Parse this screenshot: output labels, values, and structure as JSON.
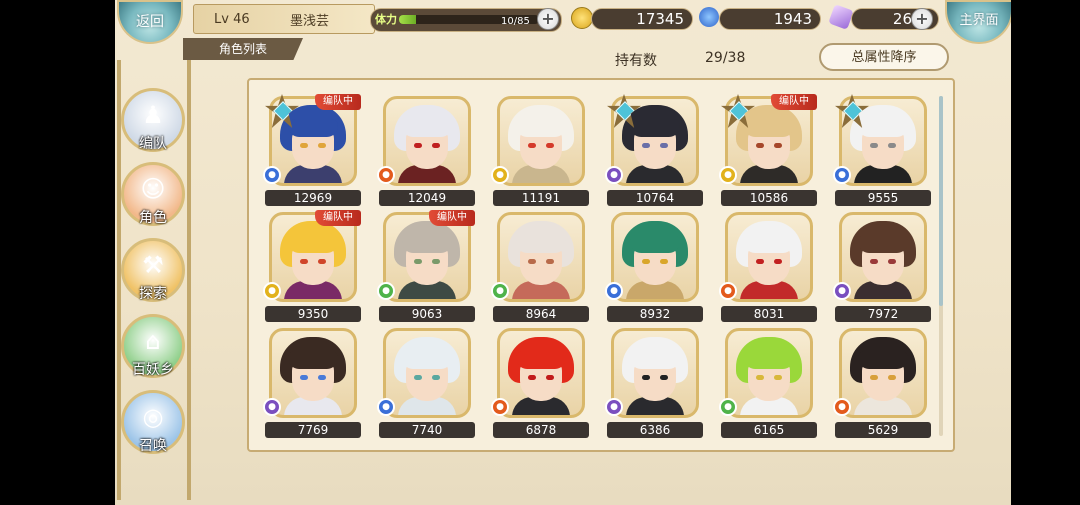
{
  "nav": {
    "back_label": "返回",
    "home_label": "主界面"
  },
  "profile": {
    "level": "Lv 46",
    "name": "墨浅芸"
  },
  "stamina": {
    "label": "体力",
    "value": "10/85",
    "fraction": 0.118
  },
  "currency": {
    "gold": {
      "value": "17345",
      "icon": "gold-coin-icon",
      "color": "#f2c230"
    },
    "spirit": {
      "value": "1943",
      "icon": "blue-flame-icon",
      "color": "#3f7dd9"
    },
    "crystal": {
      "value": "26",
      "icon": "crystal-icon",
      "color": "#b48fd4"
    }
  },
  "tab": {
    "label": "角色列表"
  },
  "owned": {
    "label": "持有数",
    "value": "29/38"
  },
  "sort_label": "总属性降序",
  "side_menu": [
    {
      "label": "编队",
      "glyph": "♟",
      "color": "#cfd9e6"
    },
    {
      "label": "角色",
      "glyph": "☺",
      "color": "#f2b88a"
    },
    {
      "label": "探索",
      "glyph": "⚒",
      "color": "#f0c266"
    },
    {
      "label": "百妖乡",
      "glyph": "⌂",
      "color": "#8fcf8a"
    },
    {
      "label": "召唤",
      "glyph": "◎",
      "color": "#9cc4e8"
    }
  ],
  "team_badge": "编队中",
  "characters": [
    {
      "power": "12969",
      "hair": "#2d4fa8",
      "eye": "#e0a53a",
      "cloth": "#3c3f6e",
      "element": "water",
      "elemColor": "#3a6fd8",
      "star": true,
      "team": true
    },
    {
      "power": "12049",
      "hair": "#e8e8ee",
      "eye": "#c02020",
      "cloth": "#6b2222",
      "element": "fire",
      "elemColor": "#e35a1c",
      "star": false,
      "team": false
    },
    {
      "power": "11191",
      "hair": "#f4f1ea",
      "eye": "#d43a2a",
      "cloth": "#c9b68e",
      "element": "light",
      "elemColor": "#e2b21c",
      "star": false,
      "team": false
    },
    {
      "power": "10764",
      "hair": "#2a2a33",
      "eye": "#6a6fa8",
      "cloth": "#2a2a2e",
      "element": "dark",
      "elemColor": "#7a4fbf",
      "star": true,
      "team": false
    },
    {
      "power": "10586",
      "hair": "#e3c58a",
      "eye": "#a6472a",
      "cloth": "#2e2b28",
      "element": "light",
      "elemColor": "#e2b21c",
      "star": true,
      "team": true
    },
    {
      "power": "9555",
      "hair": "#f2f2f2",
      "eye": "#8a8a8a",
      "cloth": "#222222",
      "element": "water",
      "elemColor": "#3a6fd8",
      "star": true,
      "team": false
    },
    {
      "power": "9350",
      "hair": "#f4c53a",
      "eye": "#d0452a",
      "cloth": "#7a2a66",
      "element": "light",
      "elemColor": "#e2b21c",
      "star": false,
      "team": true
    },
    {
      "power": "9063",
      "hair": "#bfb6aa",
      "eye": "#7a9a6a",
      "cloth": "#3e4a44",
      "element": "wind",
      "elemColor": "#4fb34a",
      "star": false,
      "team": true
    },
    {
      "power": "8964",
      "hair": "#e9e2dc",
      "eye": "#b86a4a",
      "cloth": "#c56a5a",
      "element": "wind",
      "elemColor": "#4fb34a",
      "star": false,
      "team": false
    },
    {
      "power": "8932",
      "hair": "#2a8a6a",
      "eye": "#d9a62a",
      "cloth": "#c9a76a",
      "element": "water",
      "elemColor": "#3a6fd8",
      "star": false,
      "team": false
    },
    {
      "power": "8031",
      "hair": "#f2f2f2",
      "eye": "#c22020",
      "cloth": "#c22a2a",
      "element": "fire",
      "elemColor": "#e35a1c",
      "star": false,
      "team": false
    },
    {
      "power": "7972",
      "hair": "#5a3a2a",
      "eye": "#9a3a3a",
      "cloth": "#3a2e30",
      "element": "dark",
      "elemColor": "#7a4fbf",
      "star": false,
      "team": false
    },
    {
      "power": "7769",
      "hair": "#3a2a22",
      "eye": "#4a7ad8",
      "cloth": "#e8e8ee",
      "element": "dark",
      "elemColor": "#7a4fbf",
      "star": false,
      "team": false
    },
    {
      "power": "7740",
      "hair": "#e8eef2",
      "eye": "#5aa8a0",
      "cloth": "#dfe6ea",
      "element": "water",
      "elemColor": "#3a6fd8",
      "star": false,
      "team": false
    },
    {
      "power": "6878",
      "hair": "#e22a1a",
      "eye": "#c21a1a",
      "cloth": "#2a2a2e",
      "element": "fire",
      "elemColor": "#e35a1c",
      "star": false,
      "team": false
    },
    {
      "power": "6386",
      "hair": "#f2f2f2",
      "eye": "#222222",
      "cloth": "#2a2a2e",
      "element": "dark",
      "elemColor": "#7a4fbf",
      "star": false,
      "team": false
    },
    {
      "power": "6165",
      "hair": "#9ad83a",
      "eye": "#d8b83a",
      "cloth": "#f2f2f2",
      "element": "wind",
      "elemColor": "#4fb34a",
      "star": false,
      "team": false
    },
    {
      "power": "5629",
      "hair": "#2a2220",
      "eye": "#d8a03a",
      "cloth": "#ece6dc",
      "element": "fire",
      "elemColor": "#e35a1c",
      "star": false,
      "team": false
    }
  ]
}
